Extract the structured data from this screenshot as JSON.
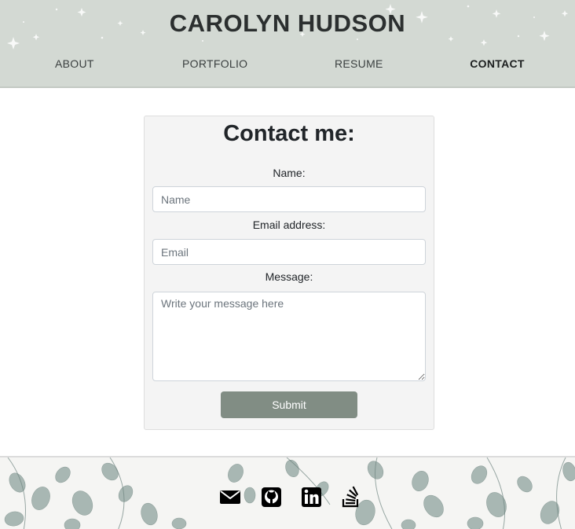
{
  "header": {
    "title": "CAROLYN HUDSON",
    "nav": [
      {
        "label": "ABOUT",
        "active": false
      },
      {
        "label": "PORTFOLIO",
        "active": false
      },
      {
        "label": "RESUME",
        "active": false
      },
      {
        "label": "CONTACT",
        "active": true
      }
    ]
  },
  "contact_form": {
    "heading": "Contact me:",
    "name": {
      "label": "Name:",
      "placeholder": "Name",
      "value": ""
    },
    "email": {
      "label": "Email address:",
      "placeholder": "Email",
      "value": ""
    },
    "message": {
      "label": "Message:",
      "placeholder": "Write your message here",
      "value": ""
    },
    "submit_label": "Submit"
  },
  "footer": {
    "social_icons": [
      "envelope-icon",
      "github-icon",
      "linkedin-icon",
      "stackoverflow-icon"
    ]
  },
  "colors": {
    "header_bg": "#d3d9d3",
    "card_bg": "#f4f4f4",
    "button_bg": "#818d84",
    "leaf": "#7f9590"
  }
}
